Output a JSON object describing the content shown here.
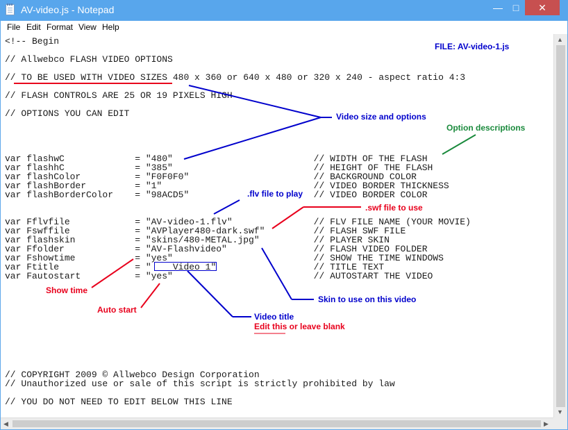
{
  "window": {
    "title": "AV-video.js - Notepad",
    "controls": {
      "minimize": "—",
      "maximize": "□",
      "close": "✕"
    }
  },
  "menu": [
    "File",
    "Edit",
    "Format",
    "View",
    "Help"
  ],
  "editor_lines": [
    "<!-- Begin",
    "// Allwebco FLASH VIDEO OPTIONS",
    "// TO BE USED WITH VIDEO SIZES 480 x 360 or 640 x 480 or 320 x 240 - aspect ratio 4:3",
    "// FLASH CONTROLS ARE 25 OR 19 PIXELS HIGH",
    "// OPTIONS YOU CAN EDIT",
    "var flashwC             = \"480\"                          // WIDTH OF THE FLASH",
    "var flashhC             = \"385\"                          // HEIGHT OF THE FLASH",
    "var flashColor          = \"F0F0F0\"                       // BACKGROUND COLOR",
    "var flashBorder         = \"1\"                            // VIDEO BORDER THICKNESS",
    "var flashBorderColor    = \"98ACD5\"                       // VIDEO BORDER COLOR",
    "var Fflvfile            = \"AV-video-1.flv\"               // FLV FILE NAME (YOUR MOVIE)",
    "var Fswffile            = \"AVPlayer480-dark.swf\"         // FLASH SWF FILE",
    "var flashskin           = \"skins/480-METAL.jpg\"          // PLAYER SKIN",
    "var Ffolder             = \"AV-Flashvideo\"                // FLASH VIDEO FOLDER",
    "var Fshowtime           = \"yes\"                          // SHOW THE TIME WINDOWS",
    "var Ftitle              = \"    Video 1\"                  // TITLE TEXT",
    "var Fautostart          = \"yes\"                          // AUTOSTART THE VIDEO",
    "// COPYRIGHT 2009 © Allwebco Design Corporation",
    "// Unauthorized use or sale of this script is strictly prohibited by law",
    "// YOU DO NOT NEED TO EDIT BELOW THIS LINE"
  ],
  "annotations": {
    "file_label": "FILE: AV-video-1.js",
    "video_size": "Video size and options",
    "option_desc": "Option descriptions",
    "flv_file": ".flv file to play",
    "swf_file": ".swf file to use",
    "skin": "Skin to use on this video",
    "show_time": "Show time",
    "auto_start": "Auto start",
    "video_title": "Video title",
    "edit_title": "Edit this or leave blank"
  },
  "colors": {
    "blue_annotation": "#0000cc",
    "red_annotation": "#e8001c",
    "green_annotation": "#1a8a3c",
    "titlebar": "#58a6ec",
    "close_button": "#c75050"
  }
}
